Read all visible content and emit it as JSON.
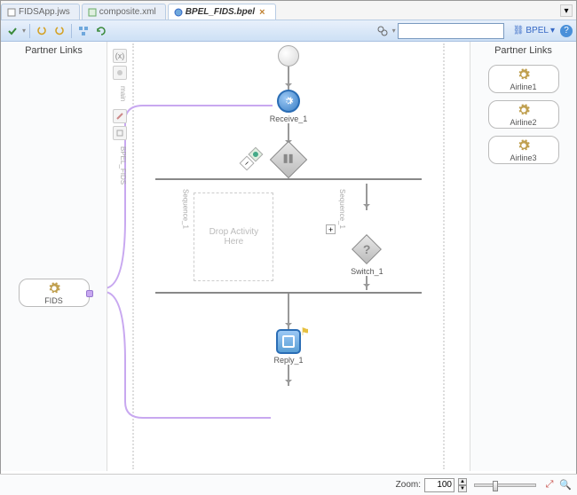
{
  "tabs": [
    {
      "label": "FIDSApp.jws",
      "active": false
    },
    {
      "label": "composite.xml",
      "active": false
    },
    {
      "label": "BPEL_FIDS.bpel",
      "active": true
    }
  ],
  "toolbar": {
    "bpel_label": "BPEL",
    "search_placeholder": ""
  },
  "partner_links_title": "Partner Links",
  "left_partner": {
    "name": "FIDS"
  },
  "right_partners": [
    {
      "name": "Airline1"
    },
    {
      "name": "Airline2"
    },
    {
      "name": "Airline3"
    }
  ],
  "canvas": {
    "vtool_labels": [
      "main",
      "BPEL_FIDS"
    ],
    "receive_label": "Receive_1",
    "switch_label_1": "",
    "seq_label_1": "Sequence_1",
    "seq_label_2": "Sequence_1",
    "drop_hint": "Drop Activity Here",
    "switch_small_label": "Switch_1",
    "reply_label": "Reply_1"
  },
  "footer": {
    "zoom_label": "Zoom:",
    "zoom_value": "100"
  }
}
